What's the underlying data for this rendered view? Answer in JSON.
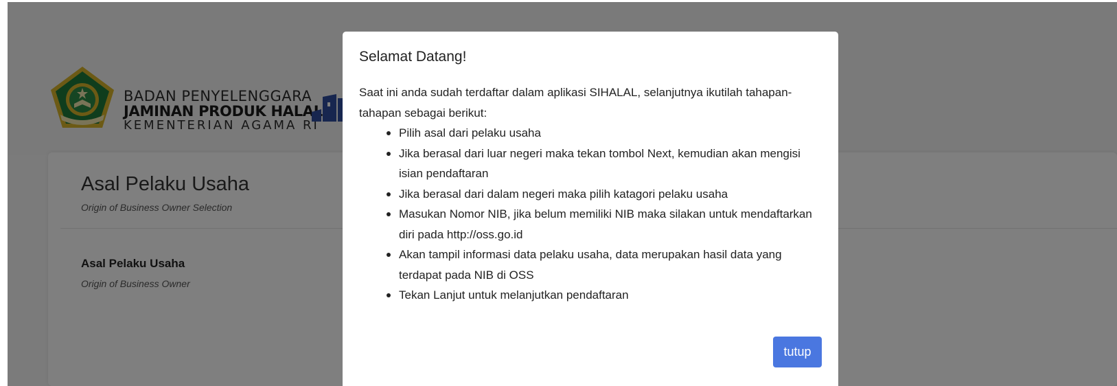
{
  "header": {
    "logo": {
      "line1": "BADAN PENYELENGGARA",
      "line2": "JAMINAN PRODUK HALAL",
      "line3": "KEMENTERIAN AGAMA RI"
    }
  },
  "card": {
    "title": "Asal Pelaku Usaha",
    "subtitle": "Origin of Business Owner Selection",
    "field_label": "Asal Pelaku Usaha",
    "field_sublabel": "Origin of Business Owner"
  },
  "modal": {
    "title": "Selamat Datang!",
    "intro": "Saat ini anda sudah terdaftar dalam aplikasi SIHALAL, selanjutnya ikutilah tahapan-tahapan sebagai berikut:",
    "steps": [
      "Pilih asal dari pelaku usaha",
      "Jika berasal dari luar negeri maka tekan tombol Next, kemudian akan mengisi isian pendaftaran",
      "Jika berasal dari dalam negeri maka pilih katagori pelaku usaha",
      "Masukan Nomor NIB, jika belum memiliki NIB maka silakan untuk mendaftarkan diri pada http://oss.go.id",
      "Akan tampil informasi data pelaku usaha, data merupakan hasil data yang terdapat pada NIB di OSS",
      "Tekan Lanjut untuk melanjutkan pendaftaran"
    ],
    "close_label": "tutup"
  },
  "colors": {
    "primary_button": "#4a77e0",
    "overlay": "rgba(0,0,0,0.5)",
    "logo_green": "#1f7a3a",
    "logo_gold": "#d9b42a"
  }
}
